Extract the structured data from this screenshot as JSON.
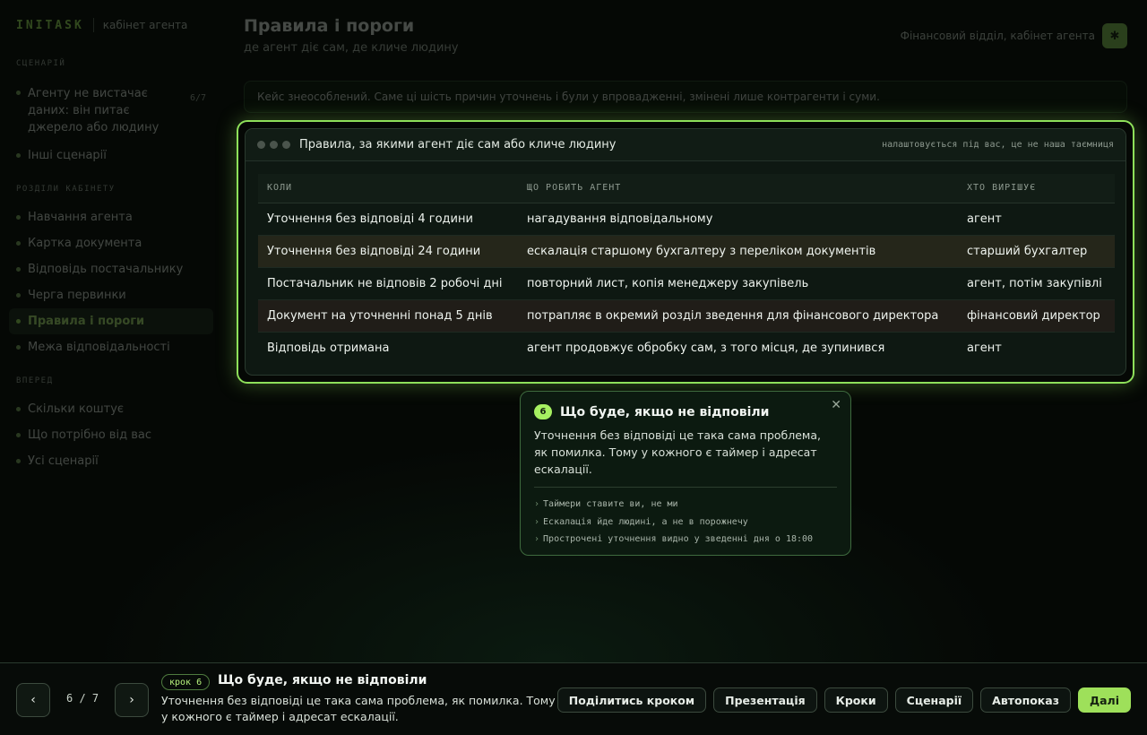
{
  "brand": {
    "logo": "INITASK",
    "subtitle": "кабінет агента"
  },
  "sidebar": {
    "scenario_head": "Сценарій",
    "scenario_item": "Агенту не вистачає даних: він питає джерело або людину",
    "scenario_count": "6/7",
    "other_scenarios": "Інші сценарії",
    "sections_head": "Розділи кабінету",
    "sections": [
      "Навчання агента",
      "Картка документа",
      "Відповідь постачальнику",
      "Черга первинки",
      "Правила і пороги",
      "Межа відповідальності"
    ],
    "active_section": "Правила і пороги",
    "next_head": "Вперед",
    "next_items": [
      "Скільки коштує",
      "Що потрібно від вас",
      "Усі сценарії"
    ]
  },
  "header": {
    "title": "Правила і пороги",
    "subtitle": "де агент діє сам, де кличе людину",
    "context": "Фінансовий відділ, кабінет агента",
    "badge_icon": "✱"
  },
  "notice": "Кейс знеособлений. Саме ці шість причин уточнень і були у впровадженні, змінені лише контрагенти і суми.",
  "rules_card": {
    "title": "Правила, за якими агент діє сам або кличе людину",
    "note": "налаштовується під вас, це не наша таємниця",
    "columns": [
      "КОЛИ",
      "ЩО РОБИТЬ АГЕНТ",
      "ХТО ВИРІШУЄ"
    ],
    "rows": [
      {
        "when": "Уточнення без відповіді 4 години",
        "action": "нагадування відповідальному",
        "who": "агент"
      },
      {
        "when": "Уточнення без відповіді 24 години",
        "action": "ескалація старшому бухгалтеру з переліком документів",
        "who": "старший бухгалтер"
      },
      {
        "when": "Постачальник не відповів 2 робочі дні",
        "action": "повторний лист, копія менеджеру закупівель",
        "who": "агент, потім закупівлі"
      },
      {
        "when": "Документ на уточненні понад 5 днів",
        "action": "потрапляє в окремий розділ зведення для фінансового директора",
        "who": "фінансовий директор"
      },
      {
        "when": "Відповідь отримана",
        "action": "агент продовжує обробку сам, з того місця, де зупинився",
        "who": "агент"
      }
    ]
  },
  "tooltip": {
    "step_number": "6",
    "title": "Що буде, якщо не відповіли",
    "body": "Уточнення без відповіді це така сама проблема, як помилка. Тому у кожного є таймер і адресат ескалації.",
    "points": [
      "Таймери ставите ви, не ми",
      "Ескалація йде людині, а не в порожнечу",
      "Прострочені уточнення видно у зведенні дня о 18:00"
    ],
    "close_glyph": "✕"
  },
  "bottom": {
    "prev_glyph": "‹",
    "next_glyph": "›",
    "counter": "6 / 7",
    "step_pill": "крок 6",
    "step_title": "Що буде, якщо не відповіли",
    "step_desc": "Уточнення без відповіді це така сама проблема, як помилка. Тому у кожного є таймер і адресат ескалації.",
    "buttons": [
      "Поділитись кроком",
      "Презентація",
      "Кроки",
      "Сценарії",
      "Автопоказ"
    ],
    "primary": "Далі"
  },
  "colors": {
    "accent": "#a6f061",
    "highlight_border": "#8ee05a",
    "background": "#060906"
  }
}
